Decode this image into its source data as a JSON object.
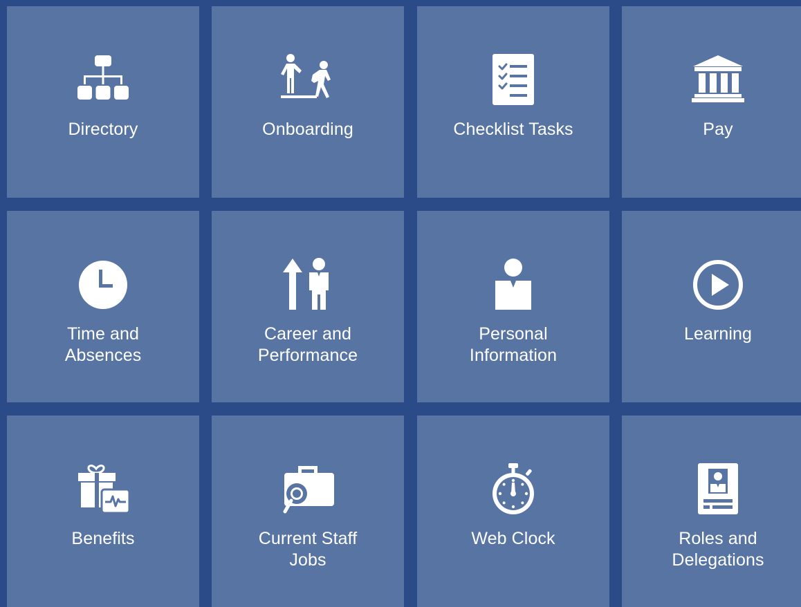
{
  "tiles": [
    {
      "key": "directory",
      "lines": [
        "Directory"
      ],
      "icon": "org-chart-icon"
    },
    {
      "key": "onboarding",
      "lines": [
        "Onboarding"
      ],
      "icon": "onboarding-people-icon"
    },
    {
      "key": "checklist-tasks",
      "lines": [
        "Checklist Tasks"
      ],
      "icon": "checklist-icon"
    },
    {
      "key": "pay",
      "lines": [
        "Pay"
      ],
      "icon": "bank-icon"
    },
    {
      "key": "time-and-absences",
      "lines": [
        "Time and",
        "Absences"
      ],
      "icon": "clock-icon"
    },
    {
      "key": "career-and-performance",
      "lines": [
        "Career and",
        "Performance"
      ],
      "icon": "career-arrow-person-icon"
    },
    {
      "key": "personal-information",
      "lines": [
        "Personal",
        "Information"
      ],
      "icon": "person-icon"
    },
    {
      "key": "learning",
      "lines": [
        "Learning"
      ],
      "icon": "play-circle-icon"
    },
    {
      "key": "benefits",
      "lines": [
        "Benefits"
      ],
      "icon": "gift-heartbeat-icon"
    },
    {
      "key": "current-staff-jobs",
      "lines": [
        "Current Staff",
        "Jobs"
      ],
      "icon": "briefcase-search-icon"
    },
    {
      "key": "web-clock",
      "lines": [
        "Web Clock"
      ],
      "icon": "stopwatch-icon"
    },
    {
      "key": "roles-and-delegations",
      "lines": [
        "Roles and",
        "Delegations"
      ],
      "icon": "id-badge-icon"
    }
  ]
}
